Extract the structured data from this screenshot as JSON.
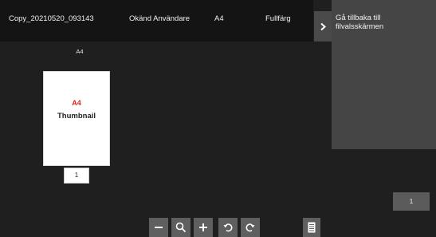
{
  "header": {
    "filename": "Copy_20210520_093143",
    "user": "Okänd Användare",
    "paper": "A4",
    "color_mode": "Fullfärg"
  },
  "side_panel": {
    "back_label": "Gå tillbaka till filvalsskärmen"
  },
  "preview": {
    "paper_label": "A4",
    "thumb_size": "A4",
    "thumb_text": "Thumbnail",
    "page_number": "1"
  },
  "page_count": "1",
  "toolbar": {
    "icons": [
      "zoom-out-icon",
      "search-icon",
      "zoom-in-icon",
      "rotate-left-icon",
      "rotate-right-icon",
      "page-list-icon"
    ]
  }
}
